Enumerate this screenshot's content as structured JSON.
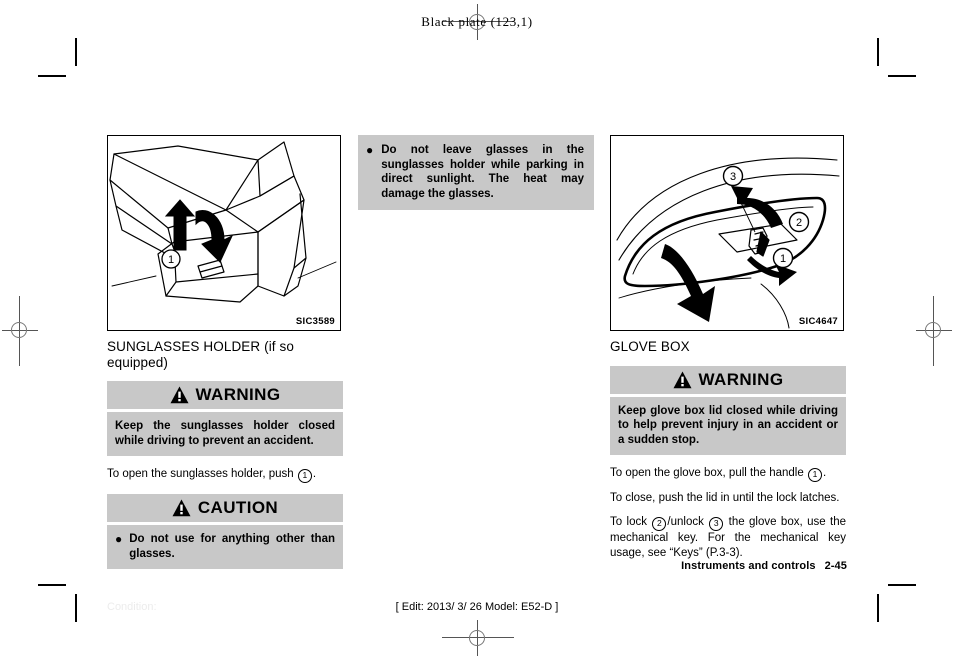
{
  "page": {
    "black_plate": "Black plate (123,1)",
    "condition_label": "Condition:",
    "edit_line": "[ Edit: 2013/ 3/ 26   Model: E52-D ]",
    "footer_chapter": "Instruments and controls",
    "footer_page": "2-45"
  },
  "left_column": {
    "figure": {
      "code": "SIC3589",
      "alt": "overhead-console-sunglasses-holder-illustration",
      "callouts": [
        "1"
      ]
    },
    "section_title": "SUNGLASSES HOLDER (if so equipped)",
    "warning": {
      "heading": "WARNING",
      "icon": "warning-triangle-icon",
      "body": "Keep the sunglasses holder closed while driving to prevent an accident."
    },
    "instruction_1_pre": "To open the sunglasses holder, push",
    "instruction_1_num": "1",
    "instruction_1_post": ".",
    "caution": {
      "heading": "CAUTION",
      "icon": "warning-triangle-icon",
      "bullet": "●",
      "body": "Do not use for anything other than glasses."
    }
  },
  "middle_column": {
    "note": {
      "bullet": "●",
      "body": "Do not leave glasses in the sunglasses holder while parking in direct sunlight. The heat may damage the glasses."
    }
  },
  "right_column": {
    "figure": {
      "code": "SIC4647",
      "alt": "glove-box-lid-illustration",
      "callouts": [
        "1",
        "2",
        "3"
      ]
    },
    "section_title": "GLOVE BOX",
    "warning": {
      "heading": "WARNING",
      "icon": "warning-triangle-icon",
      "body": "Keep glove box lid closed while driving to help prevent injury in an accident or a sudden stop."
    },
    "instruction_open_pre": "To open the glove box, pull the handle",
    "instruction_open_num": "1",
    "instruction_open_post": ".",
    "instruction_close": "To close, push the lid in until the lock latches.",
    "instruction_lock_pre": "To lock",
    "instruction_lock_num1": "2",
    "instruction_lock_mid": "/unlock",
    "instruction_lock_num2": "3",
    "instruction_lock_post": "the glove box, use the mechanical key. For the mechanical key usage, see “Keys” (P.3-3)."
  },
  "colors": {
    "gray_box": "#c8c8c8",
    "text": "#000000",
    "page_background": "#ffffff"
  }
}
